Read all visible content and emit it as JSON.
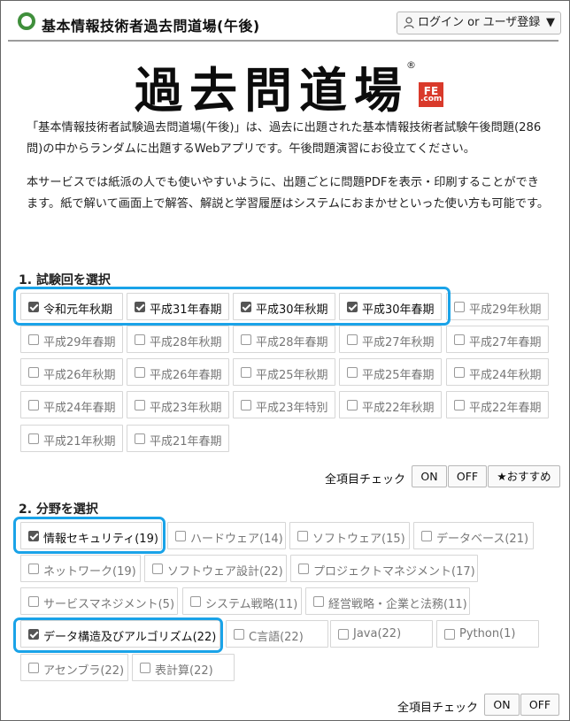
{
  "header": {
    "site_title": "基本情報技術者過去問道場(午後)",
    "login_label": "ログイン or ユーザ登録",
    "login_caret": "▼"
  },
  "brand": {
    "logo_text": "過去問道場",
    "reg_mark": "®",
    "fe_badge_top": "FE",
    "fe_badge_bottom": ".com"
  },
  "intro": {
    "paragraph1": "「基本情報技術者試験過去問道場(午後)」は、過去に出題された基本情報技術者試験午後問題(286問)の中からランダムに出題するWebアプリです。午後問題演習にお役立てください。",
    "paragraph2": "本サービスでは紙派の人でも使いやすいように、出題ごとに問題PDFを表示・印刷することができます。紙で解いて画面上で解答、解説と学習履歴はシステムにおまかせといった使い方も可能です。"
  },
  "section1": {
    "title": "1. 試験回を選択",
    "exams": [
      {
        "label": "令和元年秋期",
        "checked": true
      },
      {
        "label": "平成31年春期",
        "checked": true
      },
      {
        "label": "平成30年秋期",
        "checked": true
      },
      {
        "label": "平成30年春期",
        "checked": true
      },
      {
        "label": "平成29年秋期",
        "checked": false
      },
      {
        "label": "平成29年春期",
        "checked": false
      },
      {
        "label": "平成28年秋期",
        "checked": false
      },
      {
        "label": "平成28年春期",
        "checked": false
      },
      {
        "label": "平成27年秋期",
        "checked": false
      },
      {
        "label": "平成27年春期",
        "checked": false
      },
      {
        "label": "平成26年秋期",
        "checked": false
      },
      {
        "label": "平成26年春期",
        "checked": false
      },
      {
        "label": "平成25年秋期",
        "checked": false
      },
      {
        "label": "平成25年春期",
        "checked": false
      },
      {
        "label": "平成24年秋期",
        "checked": false
      },
      {
        "label": "平成24年春期",
        "checked": false
      },
      {
        "label": "平成23年秋期",
        "checked": false
      },
      {
        "label": "平成23年特別",
        "checked": false
      },
      {
        "label": "平成22年秋期",
        "checked": false
      },
      {
        "label": "平成22年春期",
        "checked": false
      },
      {
        "label": "平成21年秋期",
        "checked": false
      },
      {
        "label": "平成21年春期",
        "checked": false
      }
    ],
    "check_all_label": "全項目チェック",
    "on_label": "ON",
    "off_label": "OFF",
    "recommend_label": "★おすすめ"
  },
  "section2": {
    "title": "2. 分野を選択",
    "fields": [
      {
        "label": "情報セキュリティ(19)",
        "checked": true
      },
      {
        "label": "ハードウェア(14)",
        "checked": false
      },
      {
        "label": "ソフトウェア(15)",
        "checked": false
      },
      {
        "label": "データベース(21)",
        "checked": false
      },
      {
        "label": "ネットワーク(19)",
        "checked": false
      },
      {
        "label": "ソフトウェア設計(22)",
        "checked": false
      },
      {
        "label": "プロジェクトマネジメント(17)",
        "checked": false
      },
      {
        "label": "サービスマネジメント(5)",
        "checked": false
      },
      {
        "label": "システム戦略(11)",
        "checked": false
      },
      {
        "label": "経営戦略・企業と法務(11)",
        "checked": false
      },
      {
        "label": "データ構造及びアルゴリズム(22)",
        "checked": true
      },
      {
        "label": "C言語(22)",
        "checked": false
      },
      {
        "label": "Java(22)",
        "checked": false
      },
      {
        "label": "Python(1)",
        "checked": false
      },
      {
        "label": "アセンブラ(22)",
        "checked": false
      },
      {
        "label": "表計算(22)",
        "checked": false
      }
    ],
    "check_all_label": "全項目チェック",
    "on_label": "ON",
    "off_label": "OFF"
  },
  "colors": {
    "highlight": "#1aa3e8",
    "logo_green": "#3f8f3b",
    "fe_red": "#d93a2b"
  }
}
